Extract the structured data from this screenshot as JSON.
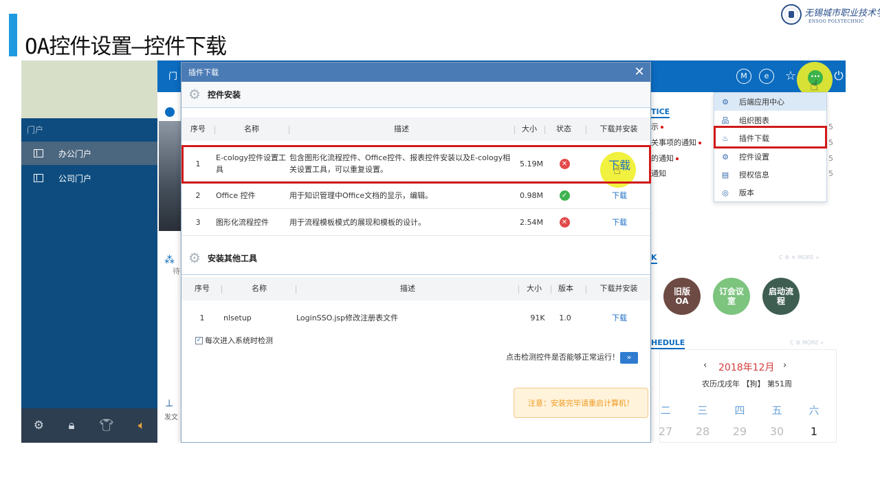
{
  "slide": {
    "title": "OA控件设置—控件下载",
    "logo_cn": "无锡城市职业技术学院",
    "logo_en": "ENSOO POLYTECHNIC"
  },
  "sidebar": {
    "section_label": "门户",
    "items": [
      {
        "label": "办公门户",
        "active": true
      },
      {
        "label": "公司门户",
        "active": false
      }
    ],
    "bottom_icons": [
      "settings-icon",
      "lock-icon",
      "shirt-icon",
      "speaker-icon"
    ]
  },
  "app_header": {
    "tab_fragment": "门",
    "icons": [
      {
        "name": "m-circle-icon",
        "glyph": "M"
      },
      {
        "name": "e-circle-icon",
        "glyph": "e"
      },
      {
        "name": "star-icon",
        "glyph": "☆"
      },
      {
        "name": "more-icon",
        "glyph": "···"
      },
      {
        "name": "power-icon",
        "glyph": "⏻"
      }
    ]
  },
  "dropdown_menu": {
    "items": [
      {
        "label": "后端应用中心",
        "icon": "gears-icon",
        "glyph": "⚙"
      },
      {
        "label": "组织图表",
        "icon": "org-chart-icon",
        "glyph": "品"
      },
      {
        "label": "插件下载",
        "icon": "plugin-icon",
        "glyph": "♨"
      },
      {
        "label": "控件设置",
        "icon": "control-settings-icon",
        "glyph": "⚙"
      },
      {
        "label": "授权信息",
        "icon": "license-icon",
        "glyph": "▤"
      },
      {
        "label": "版本",
        "icon": "version-icon",
        "glyph": "◎"
      }
    ]
  },
  "background": {
    "notice_title": "TICE",
    "notice_items": [
      "示",
      "关事项的通知",
      "的通知",
      "通知"
    ],
    "notice_counts": [
      "5",
      "5",
      "5",
      "5"
    ],
    "left_fragments": [
      "待",
      "发文"
    ],
    "shortcut_title": "K",
    "more_label": "MORE",
    "bubbles": [
      {
        "label": "旧版OA",
        "color": "#6e4a44"
      },
      {
        "label": "订会议室",
        "color": "#7dc47f"
      },
      {
        "label": "启动流程",
        "color": "#3f5e52"
      }
    ],
    "schedule_title": "HEDULE",
    "calendar": {
      "month": "2018年12月",
      "lunar": "农历戊戌年 【狗】 第51周",
      "weekdays": [
        "二",
        "三",
        "四",
        "五",
        "六"
      ],
      "days": [
        "27",
        "28",
        "29",
        "30",
        "1"
      ]
    }
  },
  "modal": {
    "title": "插件下载",
    "section1": {
      "title": "控件安装",
      "headers": [
        "序号",
        "名称",
        "描述",
        "大小",
        "状态",
        "下载并安装"
      ],
      "rows": [
        {
          "no": "1",
          "name": "E-cology控件设置工具",
          "desc": "包含图形化流程控件、Office控件、报表控件安装以及E-cology相关设置工具，可以重复设置。",
          "size": "5.19M",
          "status": "error",
          "action": "下载"
        },
        {
          "no": "2",
          "name": "Office 控件",
          "desc": "用于知识管理中Office文档的显示，编辑。",
          "size": "0.98M",
          "status": "ok",
          "action": "下载"
        },
        {
          "no": "3",
          "name": "图形化流程控件",
          "desc": "用于流程模板模式的展现和模板的设计。",
          "size": "2.54M",
          "status": "error",
          "action": "下载"
        }
      ]
    },
    "section2": {
      "title": "安装其他工具",
      "headers": [
        "序号",
        "名称",
        "描述",
        "大小",
        "版本",
        "下载并安装"
      ],
      "rows": [
        {
          "no": "1",
          "name": "nlsetup",
          "desc": "LoginSSO.jsp修改注册表文件",
          "size": "91K",
          "version": "1.0",
          "action": "下载"
        }
      ]
    },
    "checkbox_label": "每次进入系统时检测",
    "checkbox_checked": true,
    "detect_text": "点击检测控件是否能够正常运行！",
    "detect_button": "»",
    "notice": "注意：安装完毕请重启计算机！"
  },
  "colors": {
    "accent": "#1e9be0",
    "header_blue": "#0b6cc0",
    "sidebar": "#0e4c7f",
    "highlight_red": "#d01919",
    "highlight_yellow": "#f0f02a"
  }
}
